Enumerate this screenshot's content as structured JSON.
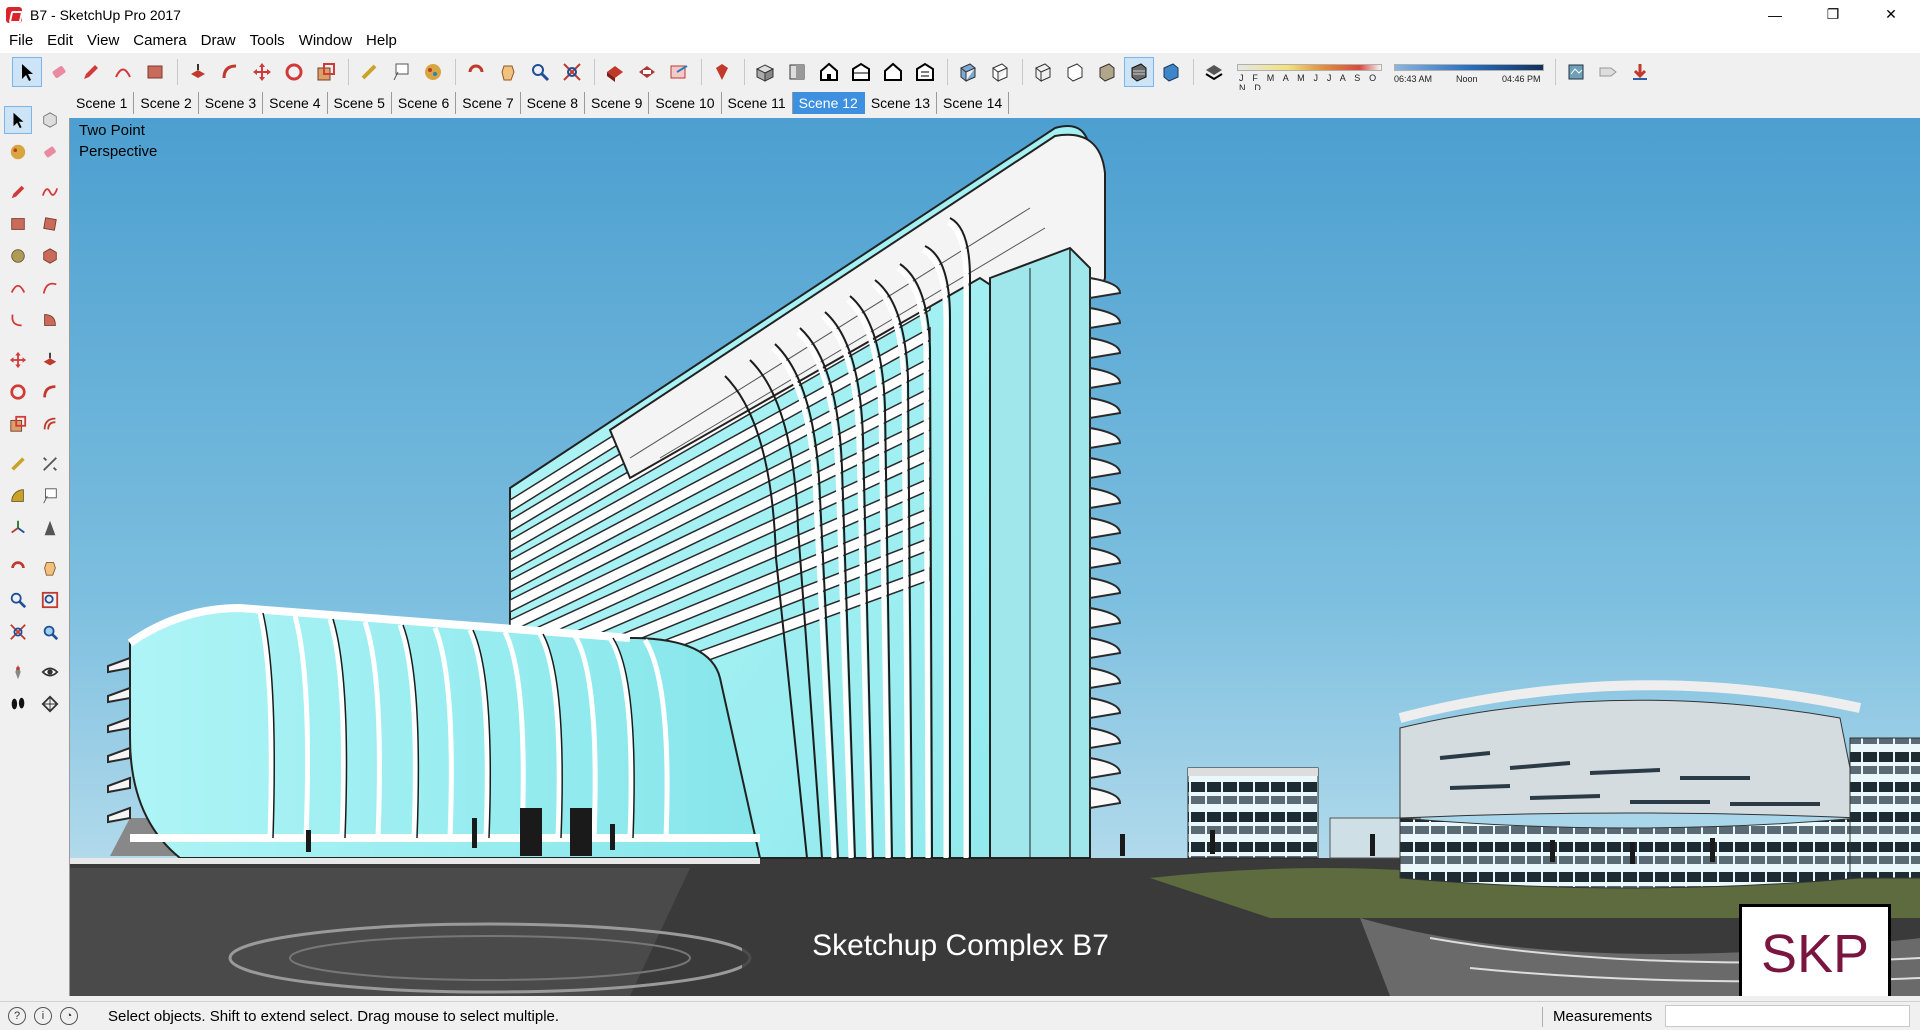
{
  "window": {
    "title": "B7 - SketchUp Pro 2017",
    "controls": [
      "—",
      "❐",
      "✕"
    ]
  },
  "menu": [
    "File",
    "Edit",
    "View",
    "Camera",
    "Draw",
    "Tools",
    "Window",
    "Help"
  ],
  "toolbar": {
    "icons": [
      "select-icon",
      "eraser-icon",
      "pencil-icon",
      "arc-icon",
      "rectangle-icon",
      "push-pull-icon",
      "follow-me-icon",
      "move-icon",
      "rotate-icon",
      "scale-icon",
      "tape-measure-icon",
      "text-icon",
      "paint-bucket-icon",
      "orbit-icon",
      "pan-icon",
      "zoom-icon",
      "zoom-extents-icon",
      "warehouse-icon",
      "extension-warehouse-icon",
      "share-model-icon",
      "ruby-icon",
      "iso-view-icon",
      "top-view-icon",
      "front-view-icon",
      "right-view-icon",
      "back-view-icon",
      "left-view-icon",
      "xray-icon",
      "back-edges-icon",
      "wireframe-icon",
      "hidden-line-icon",
      "shaded-icon",
      "shaded-textures-icon",
      "monochrome-icon",
      "shadows-icon"
    ],
    "shadow_months": "J F M A M J J A S O N D",
    "time_start": "06:43 AM",
    "time_noon": "Noon",
    "time_end": "04:46 PM",
    "right_icons": [
      "model-info-icon",
      "tag-icon",
      "download-icon"
    ]
  },
  "scenes": [
    "Scene 1",
    "Scene 2",
    "Scene 3",
    "Scene 4",
    "Scene 5",
    "Scene 6",
    "Scene 7",
    "Scene 8",
    "Scene 9",
    "Scene 10",
    "Scene 11",
    "Scene 12",
    "Scene 13",
    "Scene 14"
  ],
  "active_scene": "Scene 12",
  "viewport": {
    "camera_label": "Two Point\nPerspective",
    "caption": "Sketchup Complex B7",
    "badge": "SKP"
  },
  "status": {
    "message": "Select objects. Shift to extend select. Drag mouse to select multiple.",
    "measurements_label": "Measurements",
    "measurements_value": ""
  },
  "colors": {
    "sky_top": "#4fa3d1",
    "sky_bottom": "#c5e4f0",
    "glass": "#9ff0f2",
    "ground": "#5a5a5a",
    "active_tab": "#3d8fe0"
  }
}
